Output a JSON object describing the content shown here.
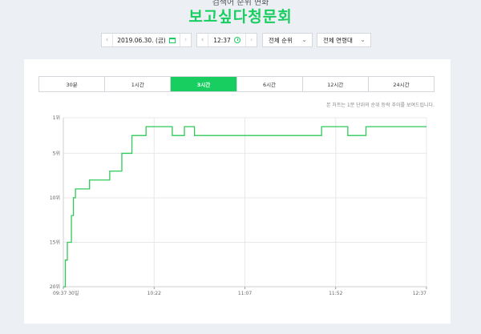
{
  "header": {
    "top_label": "검색어 순위 변화",
    "title": "보고싶다청문회"
  },
  "controls": {
    "date": "2019.06.30. (금)",
    "time": "12:37",
    "rank_filter": "전체 순위",
    "age_filter": "전체 연령대"
  },
  "tabs": [
    {
      "label": "30분",
      "active": false
    },
    {
      "label": "1시간",
      "active": false
    },
    {
      "label": "3시간",
      "active": true
    },
    {
      "label": "6시간",
      "active": false
    },
    {
      "label": "12시간",
      "active": false
    },
    {
      "label": "24시간",
      "active": false
    }
  ],
  "note": "본 차트는 1분 단위의 순위 등락 추이를 보여드립니다.",
  "colors": {
    "accent": "#19ce60",
    "line": "#2fc95a",
    "grid": "#e8e8e8"
  },
  "chart_data": {
    "type": "line",
    "title": "",
    "xlabel": "",
    "ylabel": "",
    "y_inverted": true,
    "ylim": [
      1,
      20
    ],
    "y_ticks": [
      {
        "value": 1,
        "label": "1위"
      },
      {
        "value": 5,
        "label": "5위"
      },
      {
        "value": 10,
        "label": "10위"
      },
      {
        "value": 15,
        "label": "15위"
      },
      {
        "value": 20,
        "label": "20위"
      }
    ],
    "xlim": [
      0,
      180
    ],
    "x_ticks": [
      {
        "value": 0,
        "label": "09:37 30일"
      },
      {
        "value": 45,
        "label": "10:22"
      },
      {
        "value": 90,
        "label": "11:07"
      },
      {
        "value": 135,
        "label": "11:52"
      },
      {
        "value": 180,
        "label": "12:37"
      }
    ],
    "grid": true,
    "series": [
      {
        "x": [
          0,
          1,
          2,
          4,
          5,
          6,
          13,
          23,
          29,
          34,
          41,
          46,
          54,
          60,
          65,
          81,
          100,
          117,
          128,
          139,
          141,
          150,
          163,
          180
        ],
        "y": [
          20,
          17,
          15,
          12,
          10,
          9,
          8,
          7,
          5,
          3,
          2,
          2,
          3,
          2,
          3,
          3,
          3,
          3,
          2,
          2,
          3,
          2,
          2,
          2
        ]
      }
    ]
  }
}
